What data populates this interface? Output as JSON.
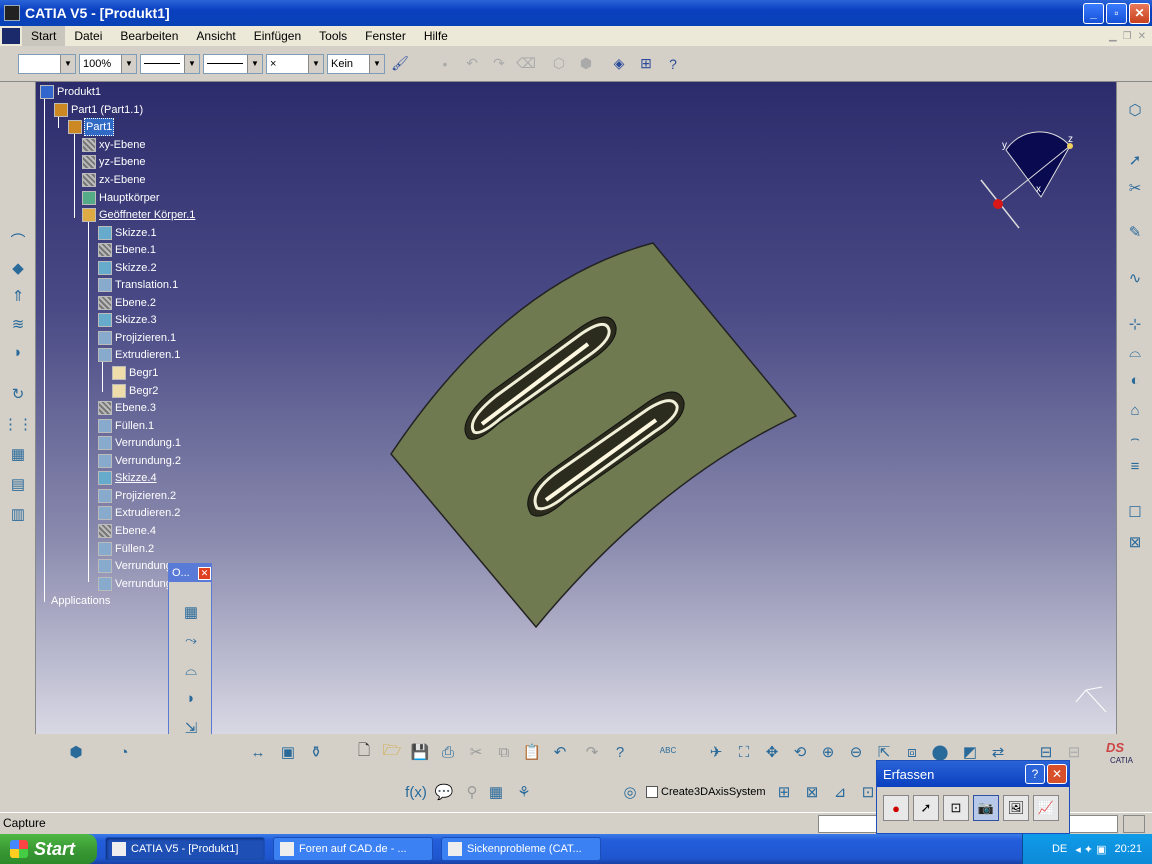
{
  "window": {
    "title": "CATIA V5 - [Produkt1]",
    "minimize": "_",
    "maximize": "▫",
    "close": "✕"
  },
  "menu": {
    "items": [
      "Start",
      "Datei",
      "Bearbeiten",
      "Ansicht",
      "Einfügen",
      "Tools",
      "Fenster",
      "Hilfe"
    ],
    "active": "Start"
  },
  "toolbar": {
    "zoom": "100%",
    "linetype": "Kein",
    "combo_x": "×"
  },
  "tree": {
    "nodes": [
      {
        "label": "Produkt1",
        "icon": "product-icon"
      },
      {
        "label": "Part1 (Part1.1)",
        "icon": "part-instance-icon"
      },
      {
        "label": "Part1",
        "icon": "part-icon",
        "selected": true
      },
      {
        "label": "xy-Ebene",
        "icon": "plane-icon"
      },
      {
        "label": "yz-Ebene",
        "icon": "plane-icon"
      },
      {
        "label": "zx-Ebene",
        "icon": "plane-icon"
      },
      {
        "label": "Hauptkörper",
        "icon": "body-icon"
      },
      {
        "label": "Geöffneter Körper.1",
        "icon": "open-body-icon",
        "underline": true
      },
      {
        "label": "Skizze.1",
        "icon": "sketch-icon"
      },
      {
        "label": "Ebene.1",
        "icon": "plane-icon"
      },
      {
        "label": "Skizze.2",
        "icon": "sketch-icon"
      },
      {
        "label": "Translation.1",
        "icon": "translation-icon"
      },
      {
        "label": "Ebene.2",
        "icon": "plane-icon"
      },
      {
        "label": "Skizze.3",
        "icon": "sketch-icon"
      },
      {
        "label": "Projizieren.1",
        "icon": "projection-icon"
      },
      {
        "label": "Extrudieren.1",
        "icon": "extrude-icon"
      },
      {
        "label": "Begr1",
        "icon": "limit-icon"
      },
      {
        "label": "Begr2",
        "icon": "limit-icon"
      },
      {
        "label": "Ebene.3",
        "icon": "plane-icon"
      },
      {
        "label": "Füllen.1",
        "icon": "fill-icon"
      },
      {
        "label": "Verrundung.1",
        "icon": "fillet-icon"
      },
      {
        "label": "Verrundung.2",
        "icon": "fillet-icon"
      },
      {
        "label": "Skizze.4",
        "icon": "sketch-icon",
        "underline": true
      },
      {
        "label": "Projizieren.2",
        "icon": "projection-icon"
      },
      {
        "label": "Extrudieren.2",
        "icon": "extrude-icon"
      },
      {
        "label": "Ebene.4",
        "icon": "plane-icon"
      },
      {
        "label": "Füllen.2",
        "icon": "fill-icon"
      },
      {
        "label": "Verrundung",
        "icon": "fillet-icon"
      },
      {
        "label": "Verrundung",
        "icon": "fillet-icon"
      },
      {
        "label": "Applications",
        "icon": ""
      }
    ]
  },
  "compass": {
    "x": "x",
    "y": "y",
    "z": "z"
  },
  "floating_panel": {
    "title": "O...",
    "close": "✕"
  },
  "bottom": {
    "create3d": "Create3DAxisSystem",
    "abc": "ABC"
  },
  "brand": {
    "ds": "DS",
    "catia": "CATIA"
  },
  "status": {
    "text": "Capture"
  },
  "erfassen": {
    "title": "Erfassen",
    "help": "?",
    "close": "✕"
  },
  "taskbar": {
    "start": "Start",
    "tasks": [
      "CATIA V5 - [Produkt1]",
      "Foren auf CAD.de - ...",
      "Sickenprobleme (CAT..."
    ],
    "lang": "DE",
    "time": "20:21"
  }
}
